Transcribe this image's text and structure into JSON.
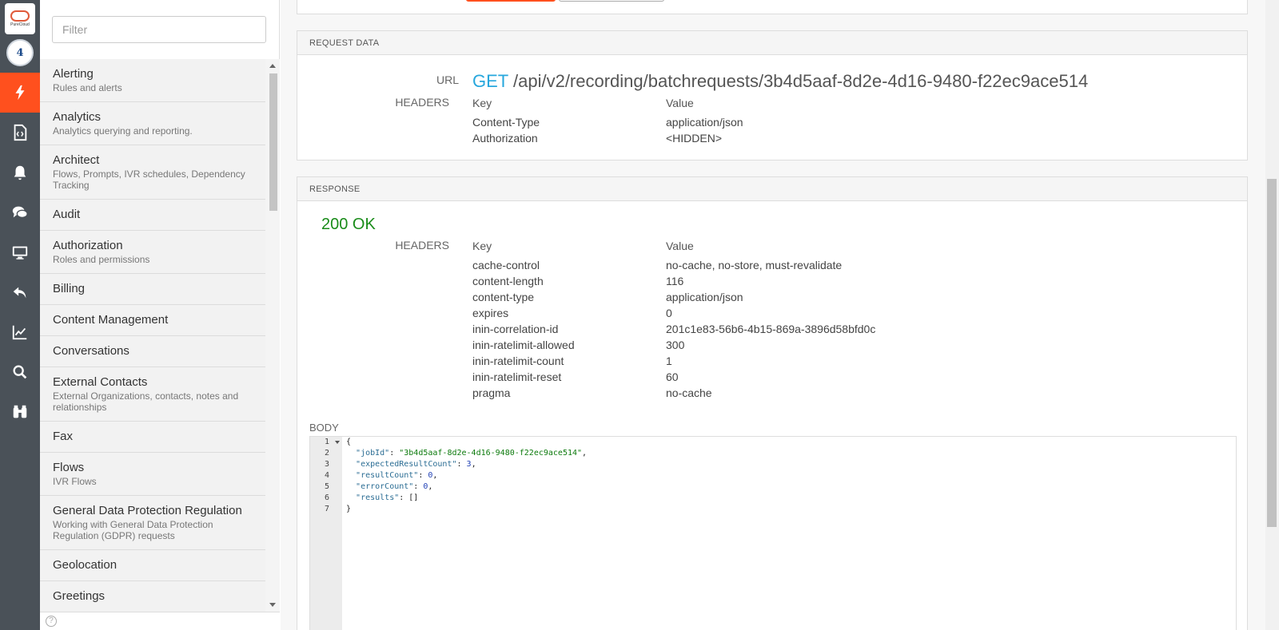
{
  "rail": {
    "logo_text": "PureCloud",
    "solve_text": "4",
    "items": [
      {
        "icon": "lightning-icon",
        "active": true
      },
      {
        "icon": "document-code-icon",
        "active": false
      },
      {
        "icon": "bell-icon",
        "active": false
      },
      {
        "icon": "chat-bubbles-icon",
        "active": false
      },
      {
        "icon": "monitor-icon",
        "active": false
      },
      {
        "icon": "reply-arrow-icon",
        "active": false
      },
      {
        "icon": "line-chart-icon",
        "active": false
      },
      {
        "icon": "search-icon",
        "active": false
      },
      {
        "icon": "binoculars-icon",
        "active": false
      }
    ],
    "accent": "#ff501e",
    "background": "#4a5158"
  },
  "nav": {
    "filter_placeholder": "Filter",
    "items": [
      {
        "title": "Alerting",
        "desc": "Rules and alerts"
      },
      {
        "title": "Analytics",
        "desc": "Analytics querying and reporting."
      },
      {
        "title": "Architect",
        "desc": "Flows, Prompts, IVR schedules, Dependency Tracking"
      },
      {
        "title": "Audit",
        "desc": ""
      },
      {
        "title": "Authorization",
        "desc": "Roles and permissions"
      },
      {
        "title": "Billing",
        "desc": ""
      },
      {
        "title": "Content Management",
        "desc": ""
      },
      {
        "title": "Conversations",
        "desc": ""
      },
      {
        "title": "External Contacts",
        "desc": "External Organizations, contacts, notes and relationships"
      },
      {
        "title": "Fax",
        "desc": ""
      },
      {
        "title": "Flows",
        "desc": "IVR Flows"
      },
      {
        "title": "General Data Protection Regulation",
        "desc": "Working with General Data Protection Regulation (GDPR) requests"
      },
      {
        "title": "Geolocation",
        "desc": ""
      },
      {
        "title": "Greetings",
        "desc": ""
      }
    ],
    "help_label": "?"
  },
  "request": {
    "section_title": "REQUEST DATA",
    "url_label": "URL",
    "method": "GET",
    "path": "/api/v2/recording/batchrequests/3b4d5aaf-8d2e-4d16-9480-f22ec9ace514",
    "headers_label": "HEADERS",
    "key_col": "Key",
    "value_col": "Value",
    "headers": [
      {
        "key": "Content-Type",
        "value": "application/json"
      },
      {
        "key": "Authorization",
        "value": "<HIDDEN>"
      }
    ]
  },
  "response": {
    "section_title": "RESPONSE",
    "status": "200 OK",
    "headers_label": "HEADERS",
    "key_col": "Key",
    "value_col": "Value",
    "headers": [
      {
        "key": "cache-control",
        "value": "no-cache, no-store, must-revalidate"
      },
      {
        "key": "content-length",
        "value": "116"
      },
      {
        "key": "content-type",
        "value": "application/json"
      },
      {
        "key": "expires",
        "value": "0"
      },
      {
        "key": "inin-correlation-id",
        "value": "201c1e83-56b6-4b15-869a-3896d58bfd0c"
      },
      {
        "key": "inin-ratelimit-allowed",
        "value": "300"
      },
      {
        "key": "inin-ratelimit-count",
        "value": "1"
      },
      {
        "key": "inin-ratelimit-reset",
        "value": "60"
      },
      {
        "key": "pragma",
        "value": "no-cache"
      }
    ],
    "body_label": "BODY",
    "body_lines": [
      "1",
      "2",
      "3",
      "4",
      "5",
      "6",
      "7"
    ],
    "body": {
      "open": "{",
      "jobId_key": "\"jobId\"",
      "jobId_val": "\"3b4d5aaf-8d2e-4d16-9480-f22ec9ace514\"",
      "expected_key": "\"expectedResultCount\"",
      "expected_val": "3",
      "resultCount_key": "\"resultCount\"",
      "resultCount_val": "0",
      "errorCount_key": "\"errorCount\"",
      "errorCount_val": "0",
      "results_key": "\"results\"",
      "results_val": "[]",
      "close": "}"
    }
  }
}
